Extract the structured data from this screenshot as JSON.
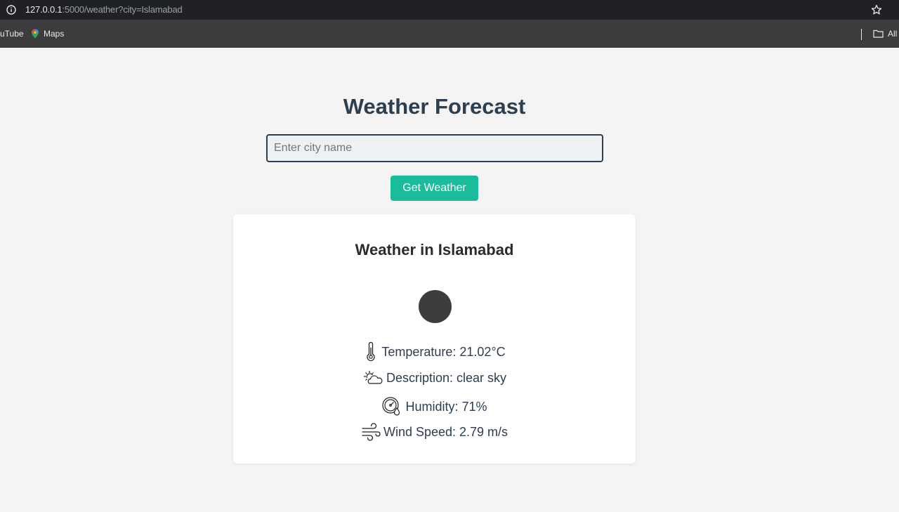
{
  "browser": {
    "url_host": "127.0.0.1",
    "url_rest": ":5000/weather?city=Islamabad",
    "bookmarks": [
      "uTube",
      "Maps"
    ],
    "all_bookmarks_label": "All"
  },
  "page": {
    "title": "Weather Forecast",
    "search": {
      "placeholder": "Enter city name",
      "value": ""
    },
    "button_label": "Get Weather"
  },
  "result": {
    "heading": "Weather in Islamabad",
    "temperature": "Temperature: 21.02°C",
    "description": "Description: clear sky",
    "humidity": "Humidity: 71%",
    "wind": "Wind Speed: 2.79 m/s"
  },
  "colors": {
    "accent": "#1abc9c",
    "heading": "#2c3e50",
    "background": "#f4f4f4"
  },
  "icons": [
    "info-icon",
    "star-icon",
    "maps-icon",
    "folder-icon",
    "thermometer-icon",
    "sun-cloud-icon",
    "humidity-gauge-icon",
    "wind-icon"
  ]
}
